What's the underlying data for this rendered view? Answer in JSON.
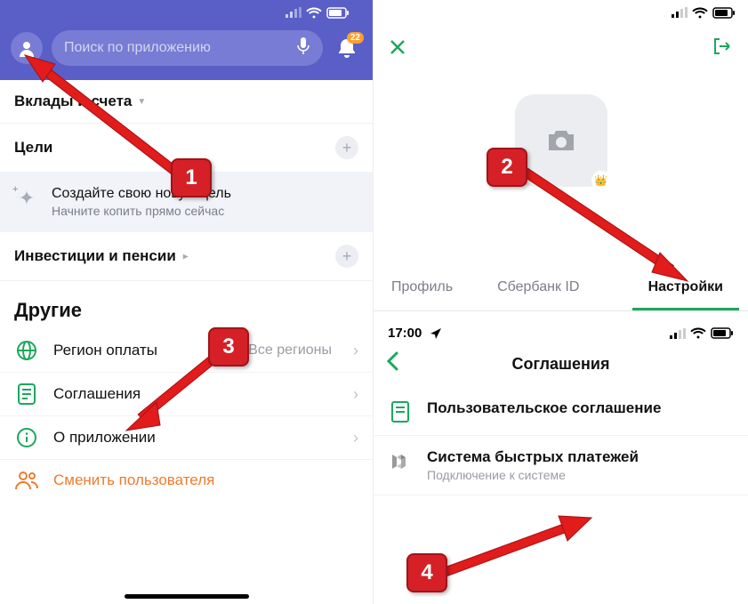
{
  "left": {
    "search_placeholder": "Поиск по приложению",
    "notif_badge": "22",
    "section_deposits": "Вклады и счета",
    "section_goals": "Цели",
    "goal_card": {
      "title": "Создайте свою новую цель",
      "sub": "Начните копить прямо сейчас"
    },
    "section_invest": "Инвестиции и пенсии",
    "others_title": "Другие",
    "rows": {
      "region": {
        "label": "Регион оплаты",
        "value": "Все регионы"
      },
      "agreements": {
        "label": "Соглашения"
      },
      "about": {
        "label": "О приложении"
      },
      "switch": {
        "label": "Сменить пользователя"
      }
    }
  },
  "right_top": {
    "tabs": {
      "profile": "Профиль",
      "sberid": "Сбербанк ID",
      "settings": "Настройки"
    }
  },
  "right_bottom": {
    "time": "17:00",
    "title": "Соглашения",
    "rows": {
      "user_agreement": "Пользовательское соглашение",
      "sbp": {
        "title": "Система быстрых платежей",
        "sub": "Подключение к системе"
      }
    }
  },
  "markers": {
    "m1": "1",
    "m2": "2",
    "m3": "3",
    "m4": "4"
  }
}
